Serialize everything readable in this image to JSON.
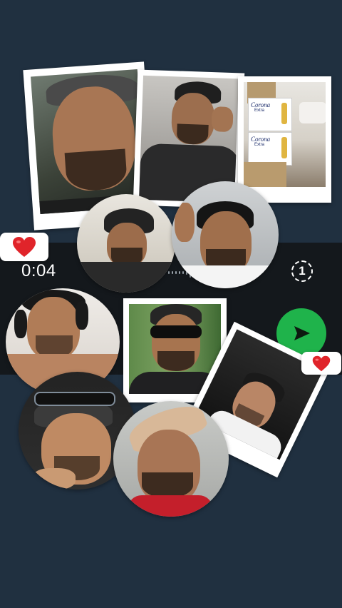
{
  "recorder": {
    "timer": "0:04",
    "view_once_label": "1"
  },
  "icons": {
    "send": "send-arrow-icon",
    "view_once": "view-once-icon",
    "heart": "heart-emoji-icon"
  },
  "colors": {
    "background": "#203040",
    "recorder_bar": "#14181c",
    "send_button": "#1fb34b",
    "heart": "#e0242a"
  },
  "photo_labels": {
    "beer_brand_top": "Corona",
    "beer_sub_top": "Extra",
    "beer_brand_bottom": "Corona",
    "beer_sub_bottom": "Extra"
  }
}
